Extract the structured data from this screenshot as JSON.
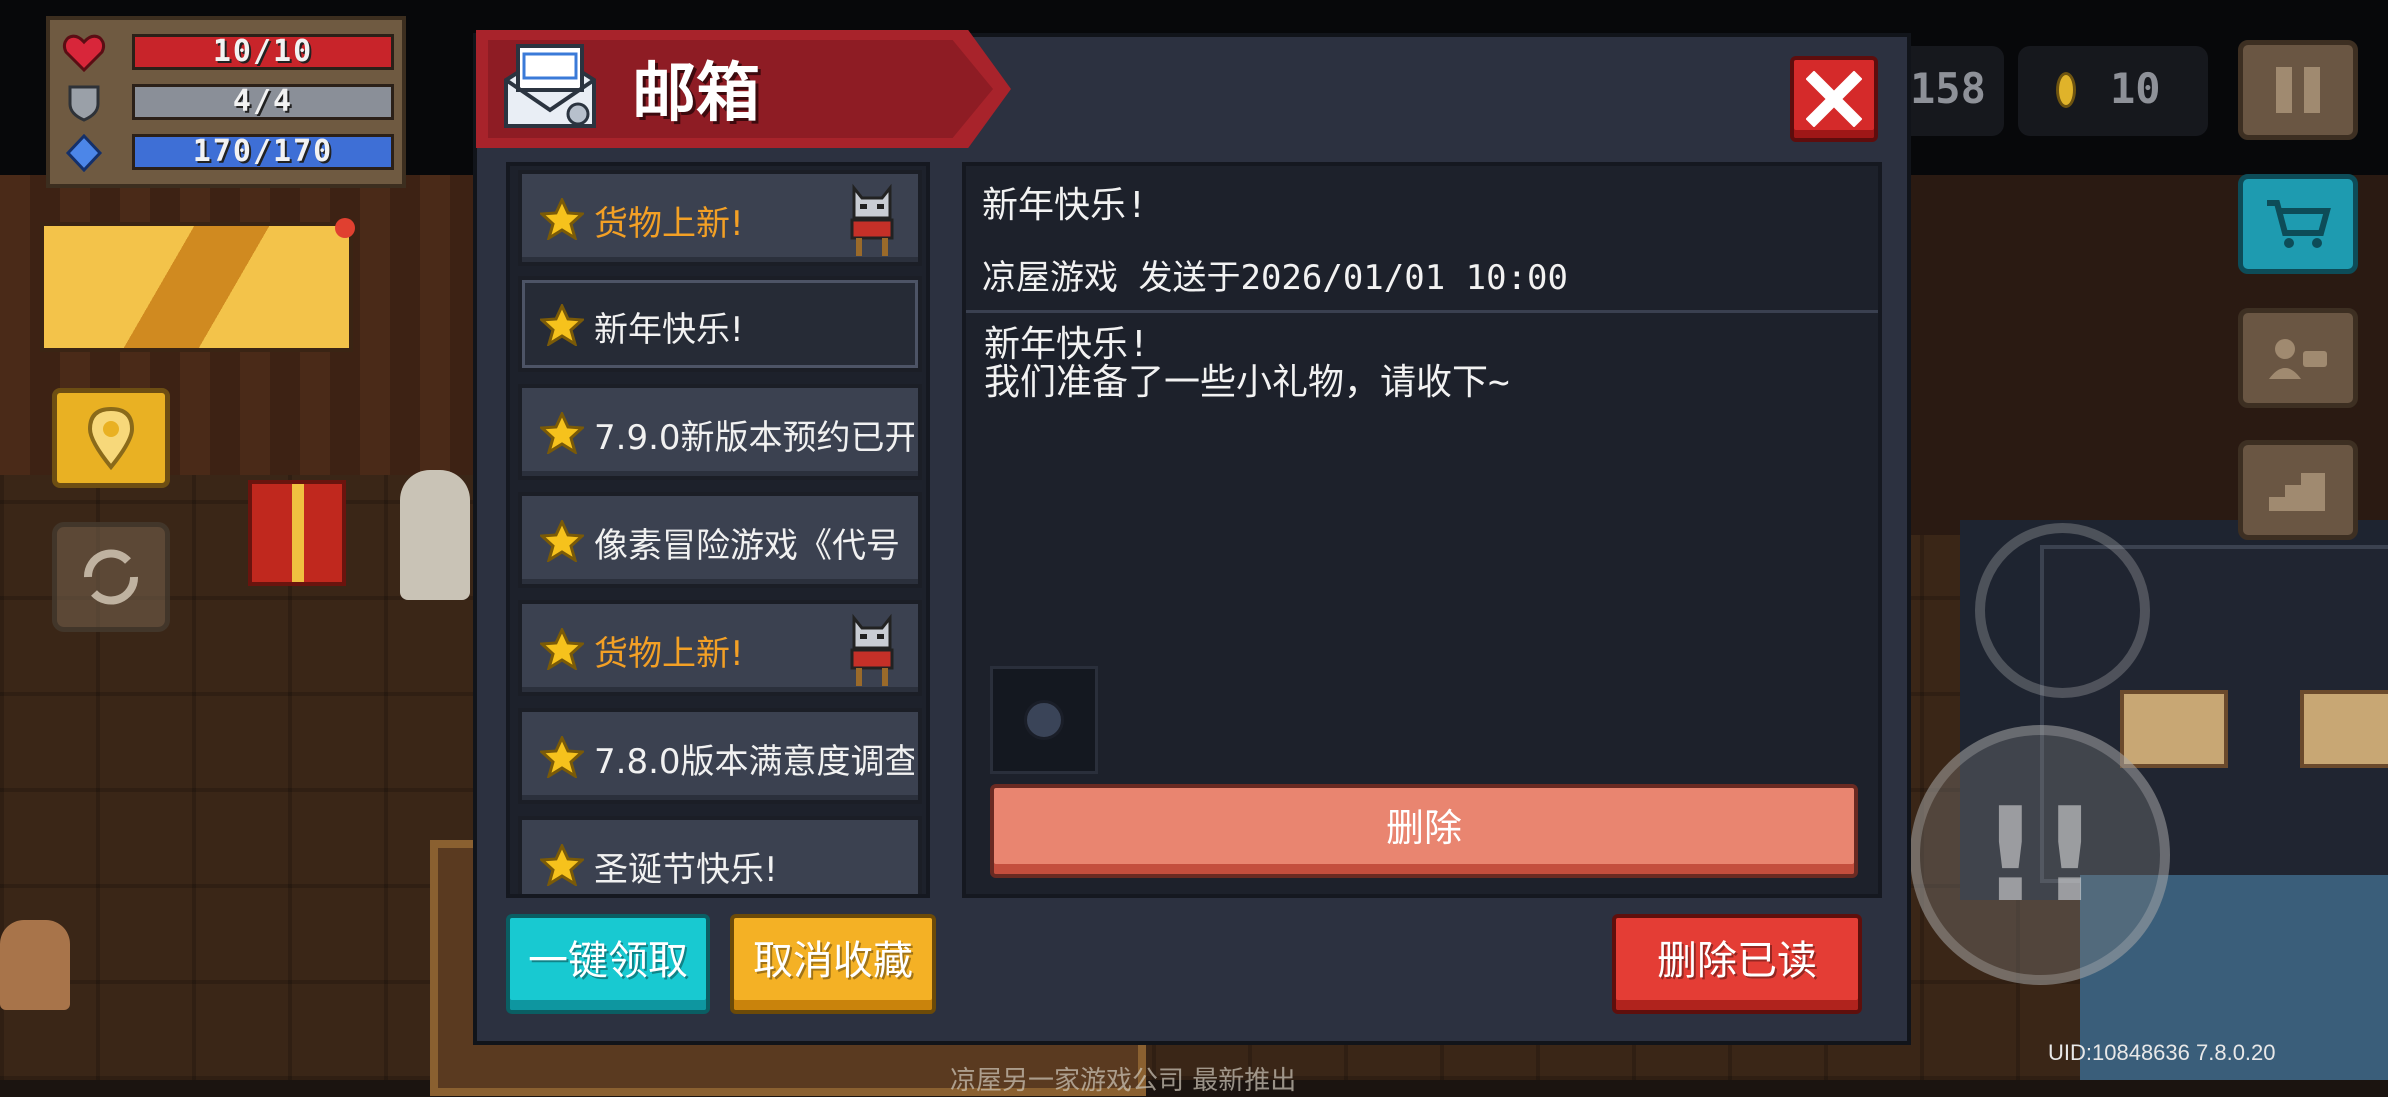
{
  "hud": {
    "health": "10/10",
    "armor": "4/4",
    "energy": "170/170",
    "gems": "158",
    "coins": "10"
  },
  "colors": {
    "health_bar": "#c8242a",
    "armor_bar": "#8a8f98",
    "energy_bar": "#3e6fd6",
    "title_ribbon": "#a8232b",
    "accent_orange": "#f3a025"
  },
  "icons": {
    "health": "heart-icon",
    "armor": "shield-icon",
    "energy": "diamond-icon",
    "mail": "mail-envelope-icon",
    "close": "close-x-icon",
    "star": "star-icon",
    "shopkeeper": "cat-shopkeeper-icon",
    "pause": "pause-icon",
    "shop": "shopping-cart-icon",
    "profile": "profile-card-icon",
    "exit": "exit-stairs-icon"
  },
  "mailbox": {
    "title": "邮箱",
    "mails": [
      {
        "label": "货物上新!",
        "style": "orange",
        "has_icon": true
      },
      {
        "label": "新年快乐!",
        "style": "normal",
        "selected": true
      },
      {
        "label": "7.9.0新版本预约已开",
        "style": "normal"
      },
      {
        "label": "像素冒险游戏《代号",
        "style": "normal"
      },
      {
        "label": "货物上新!",
        "style": "orange",
        "has_icon": true
      },
      {
        "label": "7.8.0版本满意度调查",
        "style": "normal"
      },
      {
        "label": "圣诞节快乐!",
        "style": "normal"
      }
    ],
    "detail": {
      "title": "新年快乐!",
      "sender_line": "凉屋游戏 发送于2026/01/01 10:00",
      "body": "新年快乐!\n我们准备了一些小礼物，请收下~"
    },
    "delete_label": "删除",
    "claim_all_label": "一键领取",
    "unfavorite_label": "取消收藏",
    "delete_read_label": "删除已读"
  },
  "footer": {
    "uid": "UID:10848636 7.8.0.20",
    "faint_text": "凉屋另一家游戏公司 最新推出"
  }
}
